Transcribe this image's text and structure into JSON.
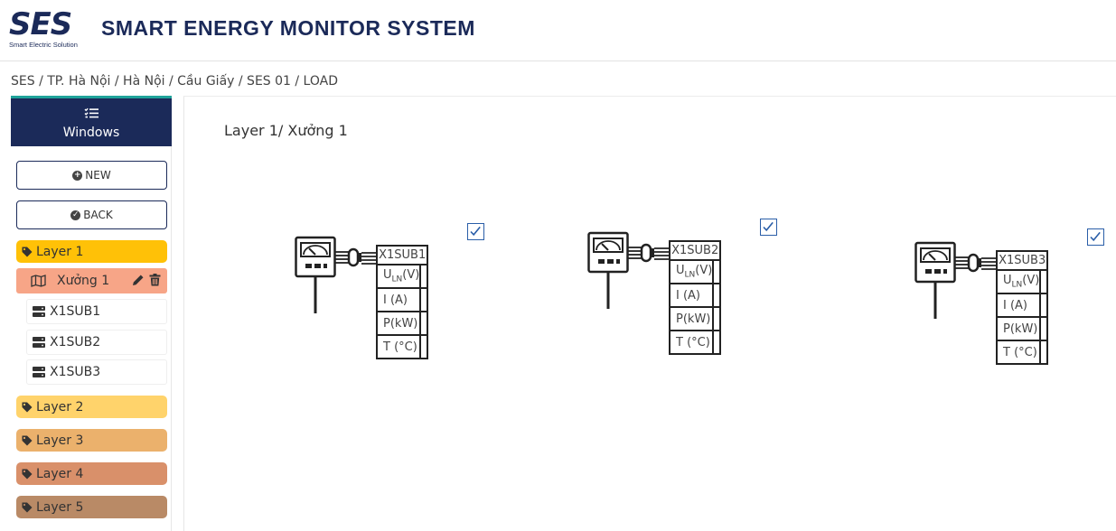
{
  "header": {
    "logo_text": "SES",
    "logo_subtitle": "Smart Electric Solution",
    "title": "SMART ENERGY MONITOR SYSTEM"
  },
  "breadcrumb": "SES / TP. Hà Nội / Hà Nội / Cầu Giấy / SES 01 / LOAD",
  "sidebar": {
    "windows_label": "Windows",
    "new_label": "NEW",
    "back_label": "BACK",
    "layers": [
      {
        "label": "Layer 1",
        "color": "#ffc107"
      },
      {
        "label": "Layer 2",
        "color": "#ffd36b"
      },
      {
        "label": "Layer 3",
        "color": "#ebb16c"
      },
      {
        "label": "Layer 4",
        "color": "#d9906a"
      },
      {
        "label": "Layer 5",
        "color": "#b98a66"
      }
    ],
    "active_area": "Xưởng 1",
    "devices": [
      "X1SUB1",
      "X1SUB2",
      "X1SUB3"
    ]
  },
  "main": {
    "title": "Layer 1/ Xưởng 1",
    "devices": [
      {
        "name": "X1SUB1",
        "checked": true,
        "rows": [
          {
            "label_main": "U",
            "label_sub": "LN",
            "label_unit": "(V)",
            "value": ""
          },
          {
            "label": "I (A)",
            "value": ""
          },
          {
            "label": "P(kW)",
            "value": ""
          },
          {
            "label": "T (°C)",
            "value": ""
          }
        ]
      },
      {
        "name": "X1SUB2",
        "checked": true,
        "rows": [
          {
            "label_main": "U",
            "label_sub": "LN",
            "label_unit": "(V)",
            "value": ""
          },
          {
            "label": "I (A)",
            "value": ""
          },
          {
            "label": "P(kW)",
            "value": ""
          },
          {
            "label": "T (°C)",
            "value": ""
          }
        ]
      },
      {
        "name": "X1SUB3",
        "checked": true,
        "rows": [
          {
            "label_main": "U",
            "label_sub": "LN",
            "label_unit": "(V)",
            "value": ""
          },
          {
            "label": "I (A)",
            "value": ""
          },
          {
            "label": "P(kW)",
            "value": ""
          },
          {
            "label": "T (°C)",
            "value": ""
          }
        ]
      }
    ]
  },
  "colors": {
    "brand_navy": "#1b2a59",
    "accent_teal": "#1fa39a",
    "active_area": "#f7a587",
    "checkbox": "#2a5ea8"
  },
  "icons": [
    "list-icon",
    "plus-circle-icon",
    "check-circle-icon",
    "tag-icon",
    "map-icon",
    "pencil-icon",
    "trash-icon",
    "server-icon",
    "meter-icon",
    "checkbox-icon"
  ]
}
